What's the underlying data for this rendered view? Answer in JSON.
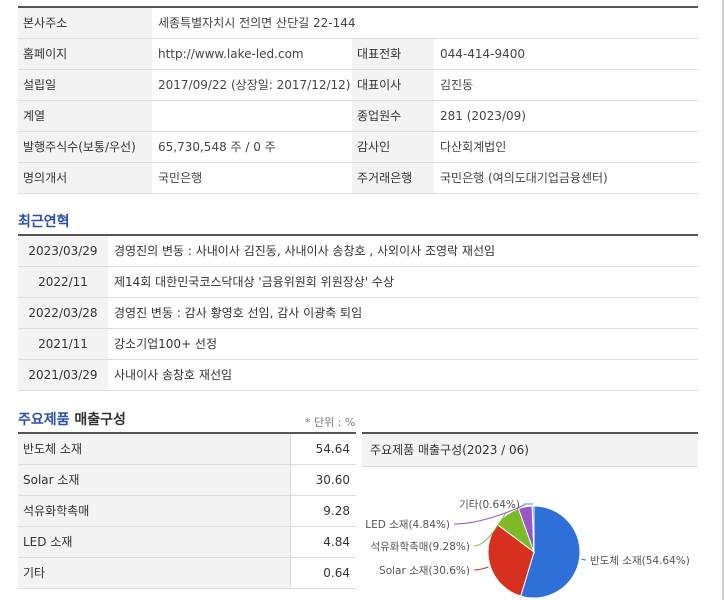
{
  "company_info": {
    "rows": [
      [
        {
          "label": "본사주소",
          "value": "세종특별자치시 전의면 산단길 22-144"
        }
      ],
      [
        {
          "label": "홈페이지",
          "value": "http://www.lake-led.com"
        },
        {
          "label": "대표전화",
          "value": "044-414-9400"
        }
      ],
      [
        {
          "label": "설립일",
          "value": "2017/09/22 (상장일: 2017/12/12)"
        },
        {
          "label": "대표이사",
          "value": "김진동"
        }
      ],
      [
        {
          "label": "계열",
          "value": ""
        },
        {
          "label": "종업원수",
          "value": "281 (2023/09)"
        }
      ],
      [
        {
          "label": "발행주식수(보통/우선)",
          "value": "65,730,548 주 / 0 주"
        },
        {
          "label": "감사인",
          "value": "다산회계법인"
        }
      ],
      [
        {
          "label": "명의개서",
          "value": "국민은행"
        },
        {
          "label": "주거래은행",
          "value": "국민은행 (여의도대기업금융센터)"
        }
      ]
    ]
  },
  "history": {
    "title": "최근연혁",
    "items": [
      {
        "date": "2023/03/29",
        "text": "경영진의 변동 : 사내이사 김진동, 사내이사 송창호 , 사외이사 조영락 재선임"
      },
      {
        "date": "2022/11",
        "text": "제14회 대한민국코스닥대상 '금융위원회 위원장상' 수상"
      },
      {
        "date": "2022/03/28",
        "text": "경영진 변동 : 감사 황영호 선임, 감사 이광축 퇴임"
      },
      {
        "date": "2021/11",
        "text": "강소기업100+ 선정"
      },
      {
        "date": "2021/03/29",
        "text": "사내이사 송창호 재선임"
      }
    ]
  },
  "products": {
    "title_blue": "주요제품",
    "title_dark": "매출구성",
    "unit": "* 단위 : %",
    "items": [
      {
        "name": "반도체 소재",
        "value": "54.64"
      },
      {
        "name": "Solar 소재",
        "value": "30.60"
      },
      {
        "name": "석유화학촉매",
        "value": "9.28"
      },
      {
        "name": "LED 소재",
        "value": "4.84"
      },
      {
        "name": "기타",
        "value": "0.64"
      }
    ],
    "chart_title": "주요제품 매출구성(2023 / 06)"
  },
  "chart_data": {
    "type": "pie",
    "title": "주요제품 매출구성(2023 / 06)",
    "categories": [
      "반도체 소재",
      "Solar 소재",
      "석유화학촉매",
      "LED 소재",
      "기타"
    ],
    "values": [
      54.64,
      30.6,
      9.28,
      4.84,
      0.64
    ],
    "labels": [
      "반도체 소재(54.64%)",
      "Solar 소재(30.6%)",
      "석유화학촉매(9.28%)",
      "LED 소재(4.84%)",
      "기타(0.64%)"
    ],
    "colors": [
      "#2f6fd8",
      "#d8301f",
      "#7dba2a",
      "#9a55c8",
      "#2aa0d8"
    ],
    "label_color": "#555555"
  }
}
